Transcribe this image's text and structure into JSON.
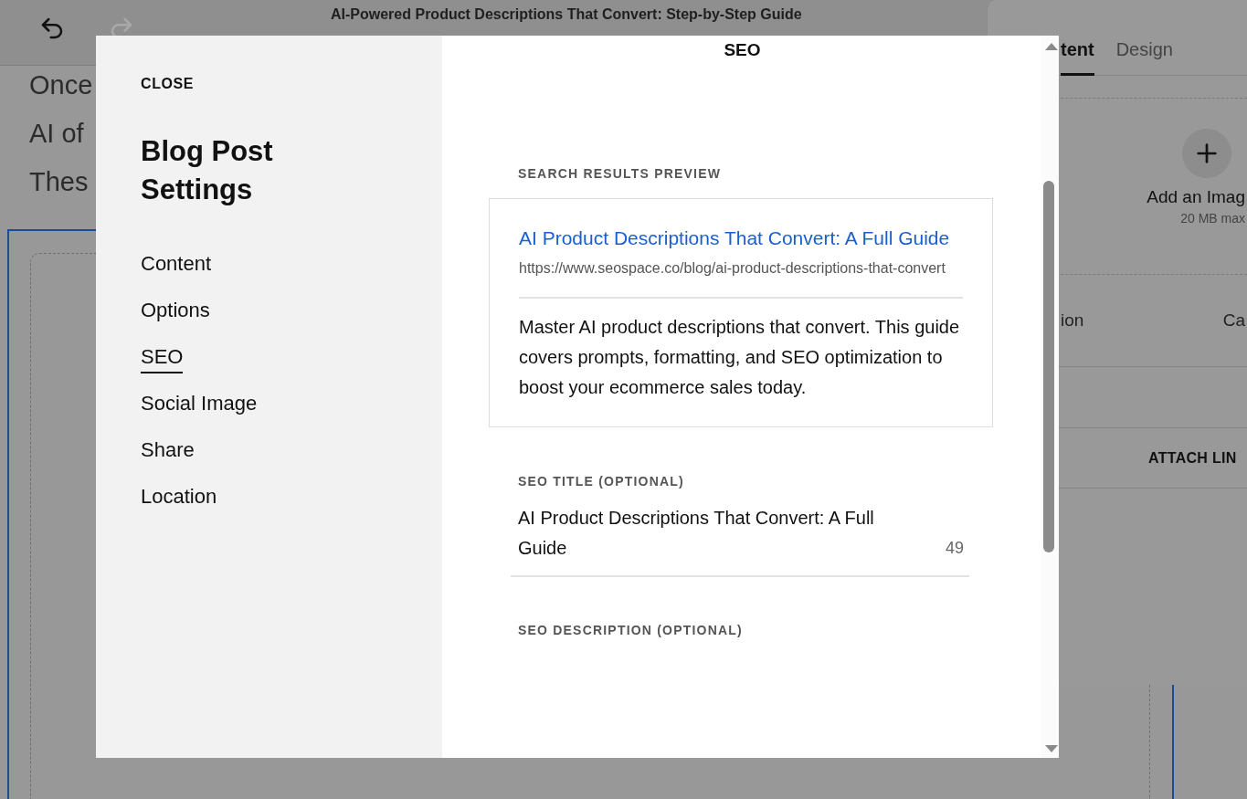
{
  "editor": {
    "title": "AI-Powered Product Descriptions That Convert: Step-by-Step Guide",
    "undo": {
      "disabled": false
    },
    "redo": {
      "disabled": true
    },
    "body_lines": [
      "Once",
      "AI of",
      "Thes"
    ]
  },
  "side_panel": {
    "tabs": [
      {
        "label": "tent",
        "selected": true
      },
      {
        "label": "Design",
        "selected": false
      }
    ],
    "image_upload": {
      "label": "Add an Imag",
      "hint": "20 MB max"
    },
    "row": {
      "column_1": "ion",
      "column_2": "Ca"
    },
    "attach_link": "ATTACH LIN"
  },
  "modal": {
    "close": "CLOSE",
    "title": "Blog Post Settings",
    "nav": [
      {
        "label": "Content",
        "selected": false
      },
      {
        "label": "Options",
        "selected": false
      },
      {
        "label": "SEO",
        "selected": true
      },
      {
        "label": "Social Image",
        "selected": false
      },
      {
        "label": "Share",
        "selected": false
      },
      {
        "label": "Location",
        "selected": false
      }
    ],
    "header": "SEO",
    "preview": {
      "label": "SEARCH RESULTS PREVIEW",
      "title": "AI Product Descriptions That Convert: A Full Guide",
      "url": "https://www.seospace.co/blog/ai-product-descriptions-that-convert",
      "description": "Master AI product descriptions that convert. This guide covers prompts, formatting, and SEO optimization to boost your ecommerce sales today."
    },
    "seo_title": {
      "label": "SEO TITLE (OPTIONAL)",
      "value": "AI Product Descriptions That Convert: A Full Guide",
      "count": "49"
    },
    "seo_description": {
      "label": "SEO DESCRIPTION (OPTIONAL)"
    }
  }
}
